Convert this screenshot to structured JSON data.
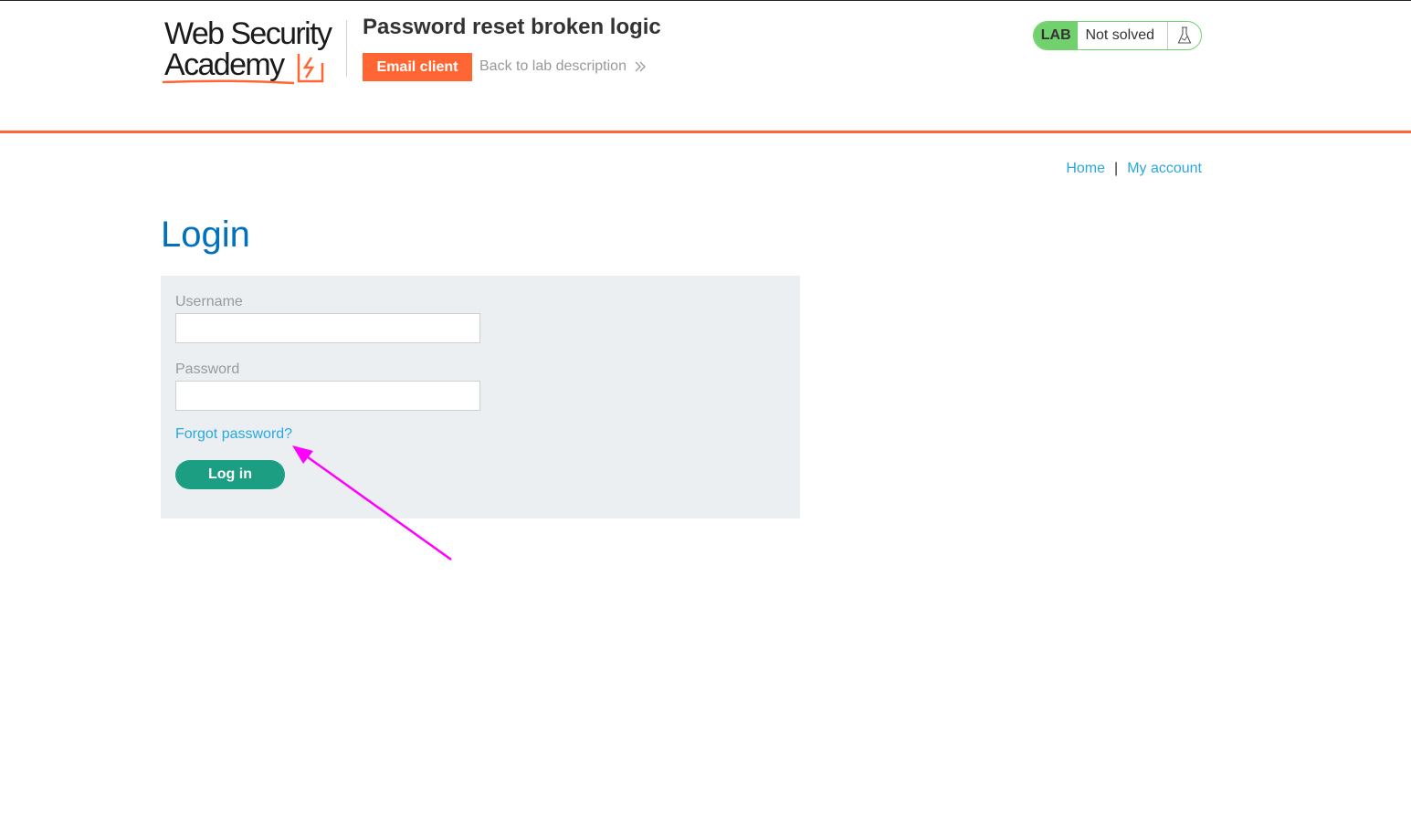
{
  "logo": {
    "line1": "Web Security",
    "line2": "Academy"
  },
  "lab": {
    "title": "Password reset broken logic",
    "email_client_label": "Email client",
    "back_link_label": "Back to lab description",
    "badge_label": "LAB",
    "status": "Not solved",
    "status_icon": "flask-icon"
  },
  "nav": {
    "home": "Home",
    "separator": "|",
    "my_account": "My account"
  },
  "login": {
    "title": "Login",
    "username_label": "Username",
    "username_value": "",
    "password_label": "Password",
    "password_value": "",
    "forgot_password": "Forgot password?",
    "submit_label": "Log in"
  },
  "colors": {
    "accent": "#ff6633",
    "link": "#29a8df",
    "heading": "#0071bc",
    "lab_badge": "#70d16d",
    "submit": "#1b9e81",
    "form_bg": "#ebeff2",
    "annotation": "#ff00ff"
  }
}
